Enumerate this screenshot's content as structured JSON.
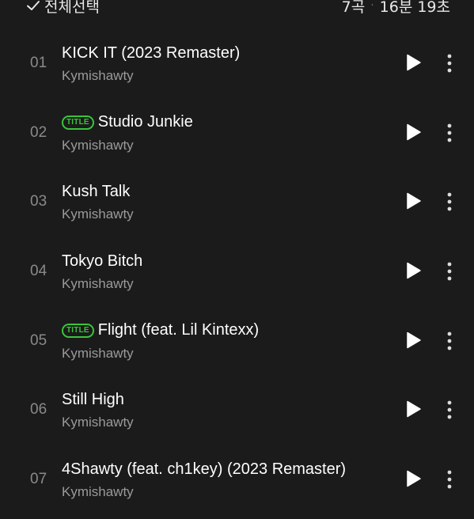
{
  "header": {
    "select_all_label": "전체선택",
    "track_count": "7곡",
    "separator": "·",
    "total_duration": "16분 19초"
  },
  "icons": {
    "check": "check-icon",
    "play": "play-icon",
    "more": "more-vertical-icon"
  },
  "colors": {
    "background": "#1b1b1b",
    "title_badge": "#3ac43a"
  },
  "tracks": [
    {
      "num": "01",
      "title": "KICK IT (2023 Remaster)",
      "artist": "Kymishawty",
      "badge": ""
    },
    {
      "num": "02",
      "title": "Studio Junkie",
      "artist": "Kymishawty",
      "badge": "TITLE"
    },
    {
      "num": "03",
      "title": "Kush Talk",
      "artist": "Kymishawty",
      "badge": ""
    },
    {
      "num": "04",
      "title": "Tokyo Bitch",
      "artist": "Kymishawty",
      "badge": ""
    },
    {
      "num": "05",
      "title": "Flight (feat. Lil Kintexx)",
      "artist": "Kymishawty",
      "badge": "TITLE"
    },
    {
      "num": "06",
      "title": "Still High",
      "artist": "Kymishawty",
      "badge": ""
    },
    {
      "num": "07",
      "title": "4Shawty (feat. ch1key) (2023 Remaster)",
      "artist": "Kymishawty",
      "badge": ""
    }
  ]
}
